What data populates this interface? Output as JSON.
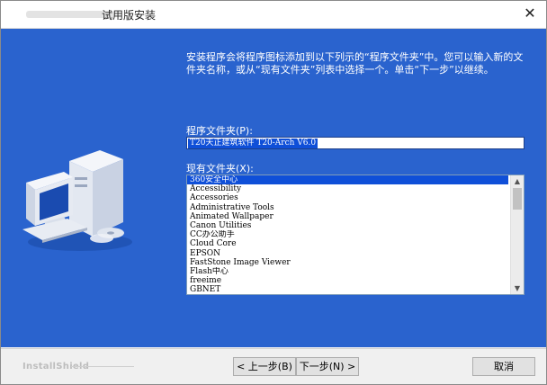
{
  "window": {
    "title": "试用版安装",
    "close_glyph": "✕"
  },
  "intro_text": "安装程序会将程序图标添加到以下列示的“程序文件夹”中。您可以输入新的文件夹名称，或从“现有文件夹”列表中选择一个。单击“下一步”以继续。",
  "program_folder": {
    "label": "程序文件夹(P):",
    "value": "T20天正建筑软件 T20-Arch V6.0"
  },
  "existing_folders": {
    "label": "现有文件夹(X):",
    "items": [
      "360安全中心",
      "Accessibility",
      "Accessories",
      "Administrative Tools",
      "Animated Wallpaper",
      "Canon Utilities",
      "CC办公助手",
      "Cloud Core",
      "EPSON",
      "FastStone Image Viewer",
      "Flash中心",
      "freeime",
      "GBNET"
    ],
    "selected_index": 0
  },
  "footer": {
    "brand": "InstallShield",
    "back_label": "< 上一步(B)",
    "next_label": "下一步(N) >",
    "cancel_label": "取消"
  },
  "colors": {
    "panel_bg": "#2a63ce",
    "selection": "#0f4fd8"
  }
}
